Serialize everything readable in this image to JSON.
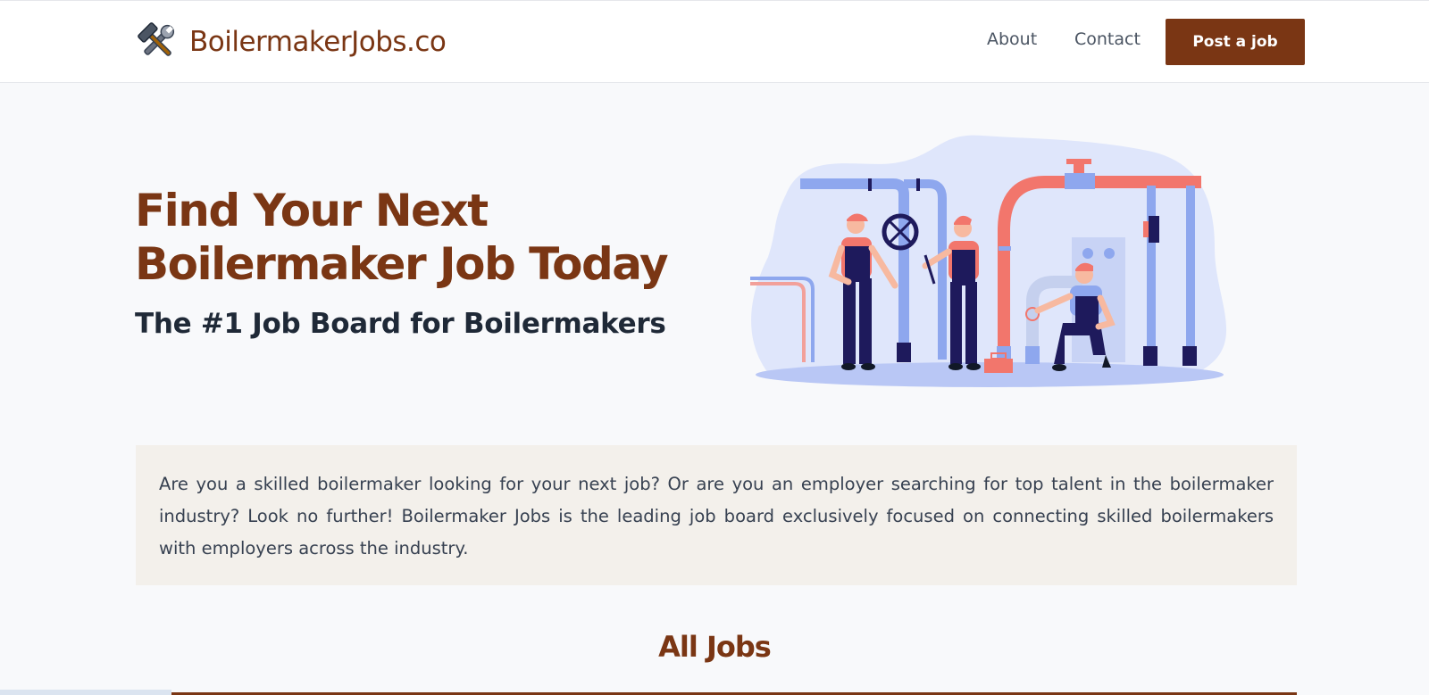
{
  "header": {
    "logo_icon": "hammer-wrench-icon",
    "logo_text": "BoilermakerJobs.co",
    "nav": [
      {
        "label": "About"
      },
      {
        "label": "Contact"
      }
    ],
    "post_button_label": "Post a job"
  },
  "hero": {
    "title": "Find Your Next Boilermaker Job Today",
    "subtitle": "The #1 Job Board for Boilermakers",
    "illustration": "workers-fixing-pipes-illustration"
  },
  "intro": {
    "text": "Are you a skilled boilermaker looking for your next job? Or are you an employer searching for top talent in the boilermaker industry? Look no further! Boilermaker Jobs is the leading job board exclusively focused on connecting skilled boilermakers with employers across the industry."
  },
  "jobs_section": {
    "title": "All Jobs"
  },
  "colors": {
    "brand": "#7a3614",
    "intro_bg": "#f3f0eb",
    "page_bg": "#f8f9fb",
    "illustration_blue": "#8ea7ee",
    "illustration_red": "#f2766c",
    "illustration_navy": "#1e1a5c"
  }
}
